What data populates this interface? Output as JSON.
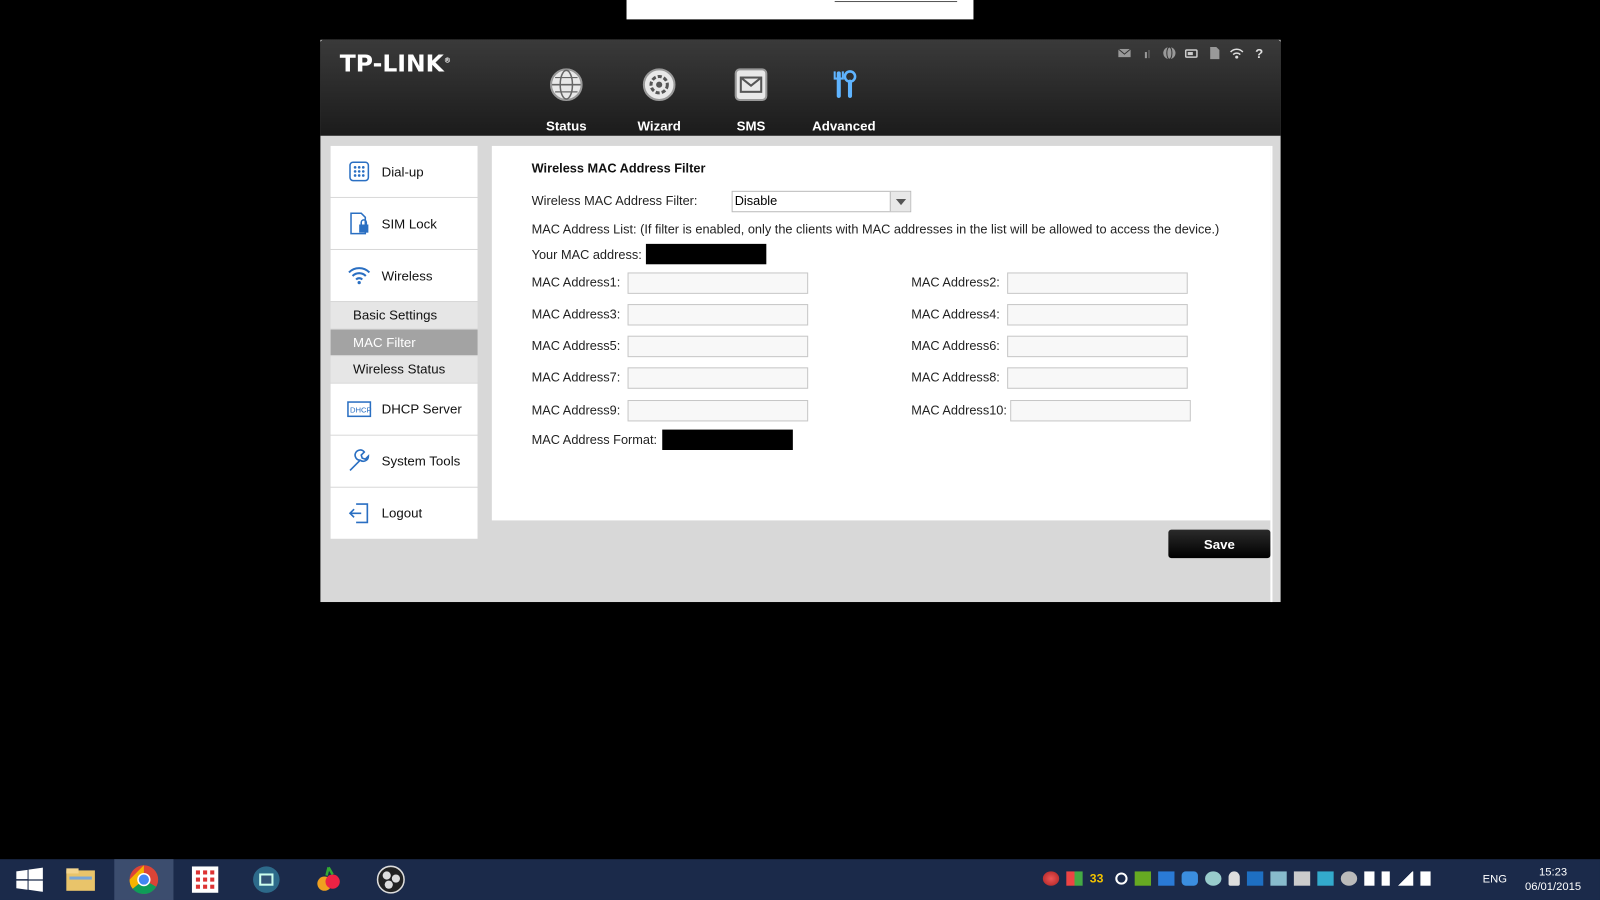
{
  "header": {
    "logo": "TP-LINK",
    "nav": [
      {
        "label": "Status",
        "icon": "globe-icon"
      },
      {
        "label": "Wizard",
        "icon": "wizard-gear-icon"
      },
      {
        "label": "SMS",
        "icon": "envelope-icon"
      },
      {
        "label": "Advanced",
        "icon": "tools-icon"
      }
    ],
    "status_icons": [
      "mail-icon",
      "signal-icon",
      "globe-icon",
      "battery-icon",
      "sim-card-icon",
      "wifi-icon",
      "help-icon"
    ]
  },
  "sidebar": {
    "items": [
      {
        "label": "Dial-up",
        "icon": "dialpad-icon"
      },
      {
        "label": "SIM Lock",
        "icon": "sim-lock-icon"
      },
      {
        "label": "Wireless",
        "icon": "wifi-icon"
      }
    ],
    "sub_items": [
      {
        "label": "Basic Settings",
        "active": false
      },
      {
        "label": "MAC Filter",
        "active": true
      },
      {
        "label": "Wireless Status",
        "active": false
      }
    ],
    "items_after": [
      {
        "label": "DHCP Server",
        "icon": "dhcp-icon"
      },
      {
        "label": "System Tools",
        "icon": "wrench-icon"
      },
      {
        "label": "Logout",
        "icon": "logout-icon"
      }
    ]
  },
  "main": {
    "title": "Wireless MAC Address Filter",
    "filter_label": "Wireless MAC Address Filter:",
    "filter_value": "Disable",
    "list_note": "MAC Address List: (If filter is enabled, only the clients with MAC addresses in the list will be allowed to access the device.)",
    "your_mac_label": "Your MAC address:",
    "mac_fields": [
      {
        "label": "MAC Address1:",
        "value": ""
      },
      {
        "label": "MAC Address2:",
        "value": ""
      },
      {
        "label": "MAC Address3:",
        "value": ""
      },
      {
        "label": "MAC Address4:",
        "value": ""
      },
      {
        "label": "MAC Address5:",
        "value": ""
      },
      {
        "label": "MAC Address6:",
        "value": ""
      },
      {
        "label": "MAC Address7:",
        "value": ""
      },
      {
        "label": "MAC Address8:",
        "value": ""
      },
      {
        "label": "MAC Address9:",
        "value": ""
      },
      {
        "label": "MAC Address10:",
        "value": ""
      }
    ],
    "format_label": "MAC Address Format:",
    "save_label": "Save"
  },
  "taskbar": {
    "apps": [
      "windows-start-icon",
      "file-explorer-icon",
      "chrome-icon",
      "apps-grid-icon",
      "video-app-icon",
      "fruit-app-icon",
      "obs-icon"
    ],
    "tray_number": "33",
    "lang": "ENG",
    "time": "15:23",
    "date": "06/01/2015"
  }
}
